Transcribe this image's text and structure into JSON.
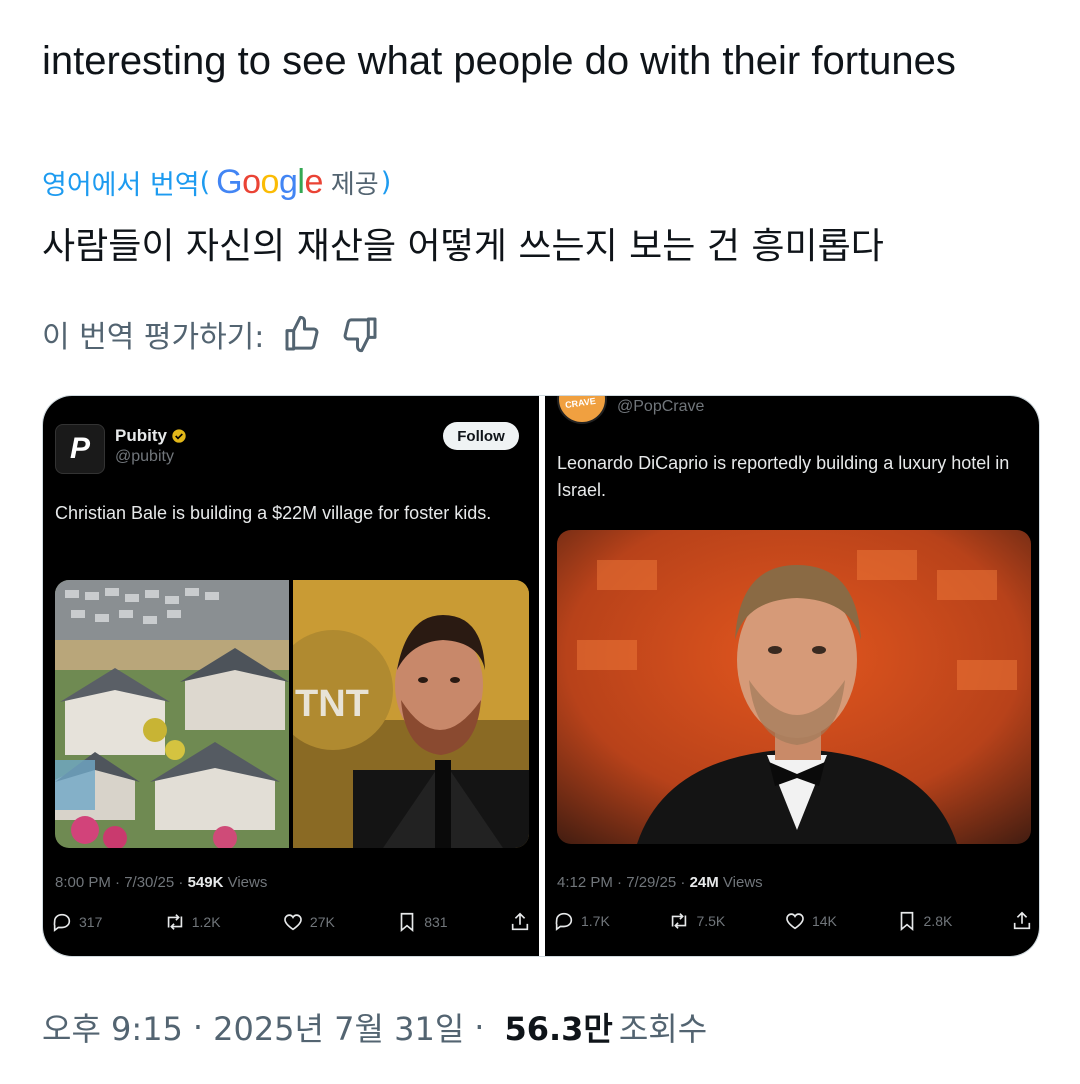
{
  "tweet": {
    "text": "interesting to see what people do with their fortunes",
    "translate": {
      "from_label": "영어에서 번역",
      "open_paren": "(",
      "provider_logo": [
        "G",
        "o",
        "o",
        "g",
        "l",
        "e"
      ],
      "provided_label": "제공",
      "close_paren": ")"
    },
    "translated_text": "사람들이 자신의 재산을 어떻게 쓰는지 보는 건 흥미롭다",
    "rate_label": "이 번역 평가하기:",
    "rate_icons": [
      "thumbs-up-icon",
      "thumbs-down-icon"
    ]
  },
  "embed_left": {
    "avatar_letter": "P",
    "name": "Pubity",
    "handle": "@pubity",
    "follow_label": "Follow",
    "text": "Christian Bale is building a $22M village for foster kids.",
    "image_sign_text": "TNT",
    "time": "8:00 PM · 7/30/25 · ",
    "views_count": "549K",
    "views_label": " Views",
    "actions": {
      "replies": "317",
      "retweets": "1.2K",
      "likes": "27K",
      "bookmarks": "831"
    }
  },
  "embed_right": {
    "avatar_text": "CRAVE",
    "handle": "@PopCrave",
    "text": "Leonardo DiCaprio is reportedly building a luxury hotel in Israel.",
    "time": "4:12 PM · 7/29/25 · ",
    "views_count": "24M",
    "views_label": " Views",
    "actions": {
      "replies": "1.7K",
      "retweets": "7.5K",
      "likes": "14K",
      "bookmarks": "2.8K"
    }
  },
  "footer": {
    "time": "오후 9:15",
    "separator": "·",
    "date": "2025년 7월 31일",
    "views_count": "56.3만",
    "views_label": "조회수"
  },
  "colors": {
    "link_blue": "#1d9bf0",
    "muted": "#536471",
    "dark_bg": "#000000",
    "verified_gold": "#e2b719"
  }
}
